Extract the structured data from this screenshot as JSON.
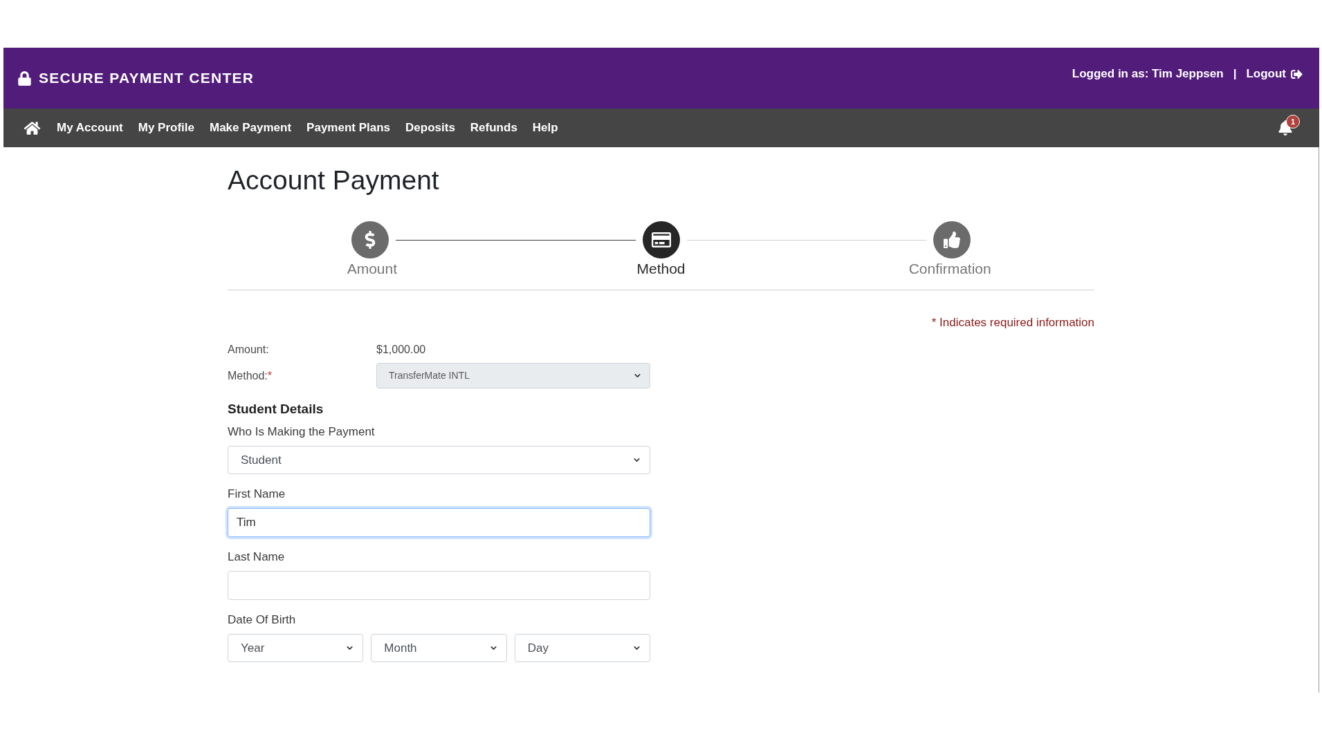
{
  "header": {
    "brand": "SECURE PAYMENT CENTER",
    "user": "Logged in as: Tim Jeppsen",
    "separator": "|",
    "logout": "Logout"
  },
  "nav": {
    "items": [
      {
        "label": "My Account"
      },
      {
        "label": "My Profile"
      },
      {
        "label": "Make Payment"
      },
      {
        "label": "Payment Plans"
      },
      {
        "label": "Deposits"
      },
      {
        "label": "Refunds"
      },
      {
        "label": "Help"
      }
    ],
    "notification_count": "1"
  },
  "page": {
    "title": "Account Payment",
    "steps": [
      {
        "label": "Amount",
        "selected": false
      },
      {
        "label": "Method",
        "selected": true
      },
      {
        "label": "Confirmation",
        "selected": false
      }
    ],
    "connectors": [
      {
        "completed": true
      },
      {
        "completed": false
      }
    ],
    "required_note": "* Indicates required information"
  },
  "summary": [
    {
      "kind": "text",
      "label": "Amount:",
      "value": "$1,000.00"
    },
    {
      "kind": "select",
      "label": "Method:",
      "required_mark": "*",
      "value": "TransferMate INTL",
      "disabled": true
    }
  ],
  "student_details": {
    "title": "Student Details",
    "fields": [
      {
        "kind": "select",
        "label": "Who Is Making the Payment",
        "value": "Student",
        "focused": false
      },
      {
        "kind": "input",
        "label": "First Name",
        "value": "Tim",
        "focused": true
      },
      {
        "kind": "input",
        "label": "Last Name",
        "focused": false
      },
      {
        "kind": "date",
        "label": "Date Of Birth",
        "parts": [
          {
            "value": "Year"
          },
          {
            "value": "Month"
          },
          {
            "value": "Day"
          }
        ]
      }
    ]
  }
}
